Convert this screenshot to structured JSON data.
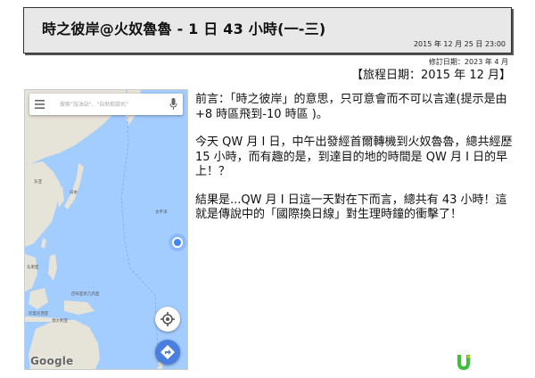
{
  "header": {
    "title": "時之彼岸@火奴魯魯  - 1 日 43 小時(一-三)",
    "datetime": "2015 年 12 月 25 日  23:00"
  },
  "meta": {
    "revised": "修訂日期：2023 年 4 月",
    "trip_date": "【旅程日期：2015 年 12 月】"
  },
  "map": {
    "search_placeholder": "搜索\"加油站\"、\"自助取款机\"",
    "logo": "Google",
    "labels": {
      "east_asia": "东亚",
      "japan": "日本",
      "pacific_ocean": "太平洋",
      "southeast_asia": "东南亚",
      "indonesia": "印度尼西亚",
      "png": "巴布亚新几内亚",
      "australia": "澳大利亚"
    },
    "icons": {
      "menu": "menu-icon",
      "mic": "mic-icon",
      "locate": "my-location-icon",
      "directions": "directions-icon"
    },
    "colors": {
      "water": "#a3ccff",
      "land": "#e6e3d9",
      "accent": "#4285f4"
    }
  },
  "content": {
    "paragraph1": "前言：「時之彼岸」的意思，只可意會而不可以言達(提示是由+8 時區飛到-10 時區 )。",
    "paragraph2": "今天 QW 月 I 日，中午出發經首爾轉機到火奴魯魯，總共經歷 15 小時，而有趣的是，到達目的地的時間是 QW 月 I 日的早上！？",
    "paragraph3": "結果是...QW 月 I 日這一天對在下而言，總共有 43 小時！這就是傳說中的「國際換日線」對生理時鐘的衝擊了！"
  },
  "brand": {
    "icon": "u-logo-icon",
    "color": "#3dbf3a"
  }
}
